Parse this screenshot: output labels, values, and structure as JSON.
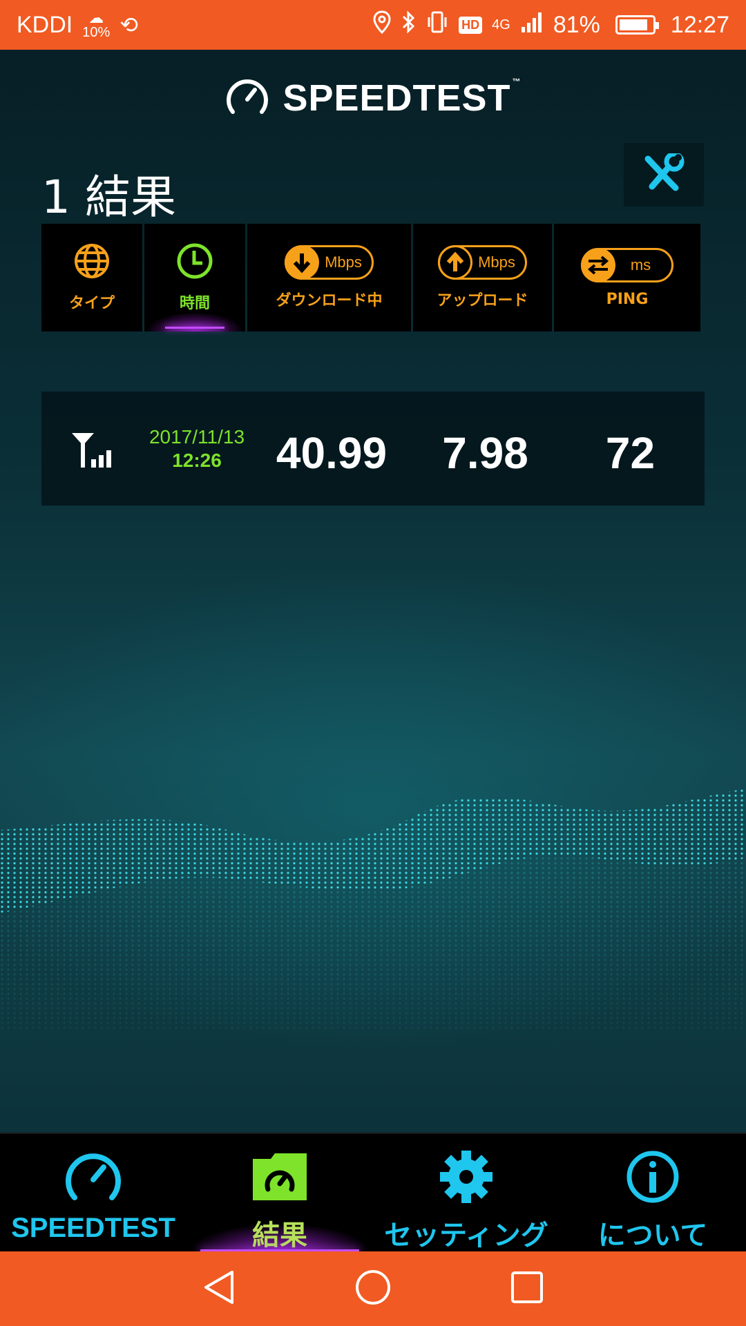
{
  "status_bar": {
    "carrier": "KDDI",
    "weather_percent": "10%",
    "network": "4G",
    "battery_percent": "81%",
    "time": "12:27",
    "hd_label": "HD"
  },
  "app": {
    "logo_text": "SPEEDTEST",
    "logo_tm": "™",
    "results_title": "1 結果"
  },
  "columns": [
    {
      "label": "タイプ",
      "icon": "globe-icon"
    },
    {
      "label": "時間",
      "icon": "clock-icon"
    },
    {
      "label": "ダウンロード中",
      "icon": "download-arrow-icon",
      "unit": "Mbps"
    },
    {
      "label": "アップロード",
      "icon": "upload-arrow-icon",
      "unit": "Mbps"
    },
    {
      "label": "PING",
      "icon": "ping-arrows-icon",
      "unit": "ms"
    }
  ],
  "results": [
    {
      "type_icon": "cellular-signal-icon",
      "date": "2017/11/13",
      "time": "12:26",
      "download": "40.99",
      "upload": "7.98",
      "ping": "72"
    }
  ],
  "bottom_nav": [
    {
      "label": "SPEEDTEST",
      "icon": "speedometer-icon"
    },
    {
      "label": "結果",
      "icon": "results-folder-icon"
    },
    {
      "label": "セッティング",
      "icon": "gear-icon"
    },
    {
      "label": "について",
      "icon": "info-icon"
    }
  ],
  "colors": {
    "accent_orange": "#f7a11a",
    "active_green": "#7ee32a",
    "nav_cyan": "#1fc6ee",
    "system_orange": "#f15a22",
    "active_glow": "#c34cff"
  }
}
